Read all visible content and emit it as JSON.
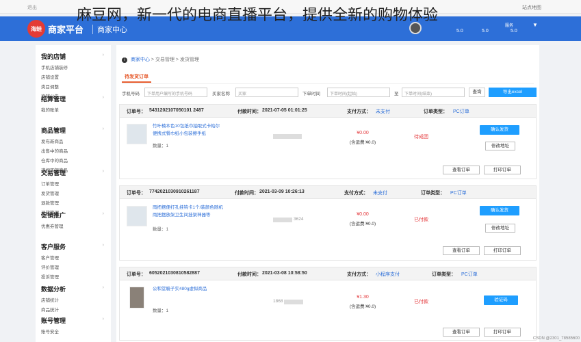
{
  "overlay_title": "麻豆网，新一代的电商直播平台，提供全新的购物体验",
  "topbar": {
    "left_text": "退出",
    "right_text": "站点地图"
  },
  "header": {
    "logo_text": "海蛙",
    "brand": "商家平台",
    "center": "商家中心",
    "service_label": "服务",
    "scores": [
      "5.0",
      "5.0",
      "5.0"
    ]
  },
  "sidebar": {
    "sections": [
      {
        "title": "我的店铺",
        "items": [
          "手机店铺装修",
          "店铺设置",
          "类目调整",
          "商铺公告"
        ]
      },
      {
        "title": "结算管理",
        "items": [
          "我的账单"
        ]
      },
      {
        "title": "商品管理",
        "items": [
          "发布新商品",
          "出售中的商品",
          "仓库中的商品",
          "违规下架商品"
        ]
      },
      {
        "title": "交易管理",
        "items": [
          "订单管理",
          "发货管理",
          "退款管理",
          "退货管理"
        ]
      },
      {
        "title": "促销推广",
        "items": [
          "优惠券管理"
        ]
      },
      {
        "title": "客户服务",
        "items": [
          "客户管理",
          "评价管理",
          "投诉管理"
        ]
      },
      {
        "title": "数据分析",
        "items": [
          "店铺统计",
          "商品统计"
        ]
      },
      {
        "title": "账号管理",
        "items": [
          "账号安全"
        ]
      }
    ]
  },
  "breadcrumb": {
    "home": "商家中心",
    "sep": ">",
    "level2": "交易管理",
    "level3": "发货管理"
  },
  "tab": "待发货订单",
  "filters": {
    "phone_label": "手机号码",
    "phone_placeholder": "下单用户编写的手机号码",
    "buyer_label": "买家名称",
    "buyer_placeholder": "买家",
    "time_label": "下单时间",
    "start_placeholder": "下单时间(起始)",
    "to": "至",
    "end_placeholder": "下单时间(结束)",
    "query_button": "查询",
    "export_button": "导出excel"
  },
  "order_labels": {
    "order_no": "订单号：",
    "paid_time": "付款时间：",
    "pay_method": "支付方式：",
    "order_type": "订单类型：",
    "qty": "数量：",
    "shipping": "(含运费:¥0.0)",
    "view": "查看订单",
    "print": "打印订单",
    "confirm_ship": "确认发货",
    "edit_address": "修改地址",
    "verify_code": "验证码"
  },
  "orders": [
    {
      "no": "5431202107050101 2487",
      "time": "2021-07-05 01:01:25",
      "pay": "未支付",
      "type": "PC订单",
      "product": "竹叶楠本色10包纸巾抽取式卡帕尔便携式餐巾纸小包装擦手纸",
      "qty": "1",
      "price": "¥0.00",
      "status": "待成团"
    },
    {
      "no": "7742021030910261187",
      "time": "2021-03-09 10:26:13",
      "pay": "未支付",
      "type": "PC订单",
      "product": "雨把摆便打孔挂钩卡1个/装颜色随机雨把摆放架卫生间挂架神器等",
      "qty": "1",
      "buyer_suffix": "3624",
      "price": "¥0.00",
      "status": "已付款"
    },
    {
      "no": "6052021030810582887",
      "time": "2021-03-08 10:58:50",
      "pay": "小程序支付",
      "type": "PC订单",
      "product": "公和堂驗子实480g虚拟商品",
      "qty": "1",
      "buyer_prefix": "1868",
      "price": "¥1.30",
      "status": "已付款"
    }
  ],
  "watermark": "CSDN @2301_78585600"
}
